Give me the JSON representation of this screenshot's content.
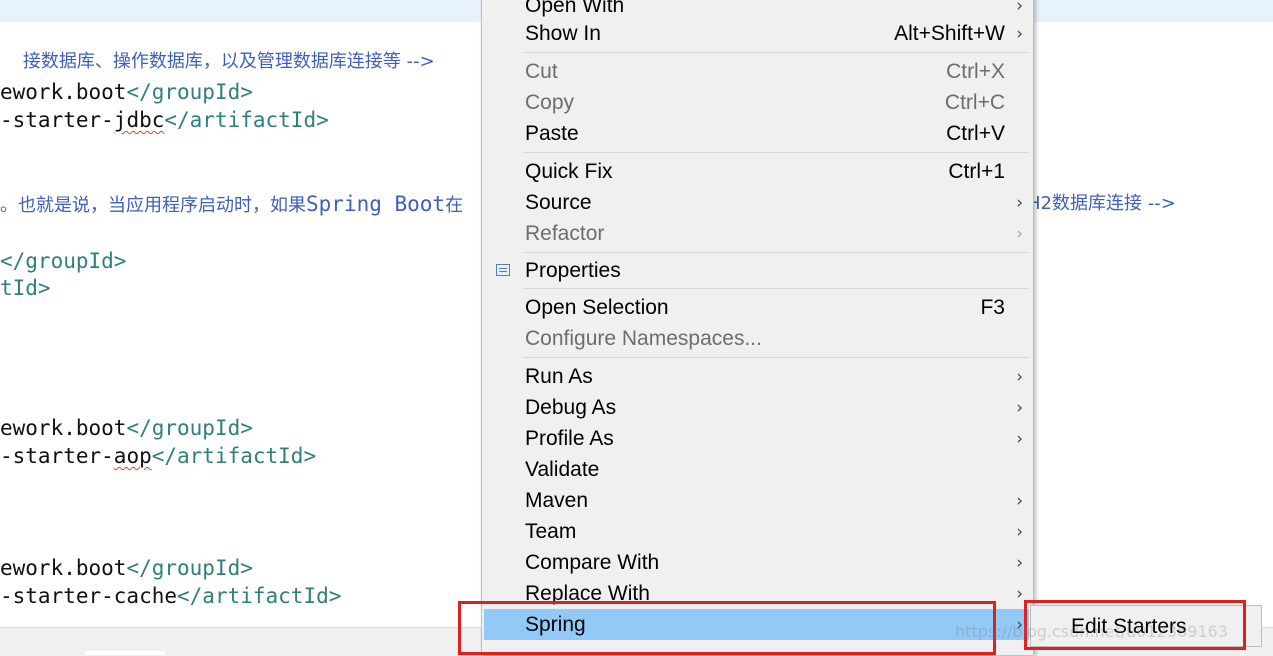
{
  "editor": {
    "comment_1": "接数据库、操作数据库，以及管理数据库连接等 -->",
    "block_1": {
      "group_pre": "ework.boot",
      "group_close": "</groupId>",
      "artifact_pre": "-starter-",
      "artifact_squig": "jdbc",
      "artifact_close": "</artifactId>"
    },
    "comment_2_text": "。也就是说，当应用程序启动时，如果",
    "comment_2_mono": "Spring Boot",
    "comment_2_tail": "在",
    "comment_2_right": "H2数据库连接 -->",
    "block_2": {
      "group_close": "</groupId>",
      "artifact_close": "tId>"
    },
    "block_3": {
      "group_pre": "ework.boot",
      "group_close": "</groupId>",
      "artifact_pre": "-starter-",
      "artifact_squig": "aop",
      "artifact_close": "</artifactId>"
    },
    "block_4": {
      "group_pre": "ework.boot",
      "group_close": "</groupId>",
      "artifact_pre": "-starter-cache",
      "artifact_close": "</artifactId>"
    }
  },
  "context_menu": {
    "items": [
      {
        "label": "Open With",
        "shortcut": "",
        "submenu": true,
        "disabled": false
      },
      {
        "label": "Show In",
        "shortcut": "Alt+Shift+W",
        "submenu": true,
        "disabled": false
      },
      {
        "label": "Cut",
        "shortcut": "Ctrl+X",
        "submenu": false,
        "disabled": true
      },
      {
        "label": "Copy",
        "shortcut": "Ctrl+C",
        "submenu": false,
        "disabled": true
      },
      {
        "label": "Paste",
        "shortcut": "Ctrl+V",
        "submenu": false,
        "disabled": false
      },
      {
        "label": "Quick Fix",
        "shortcut": "Ctrl+1",
        "submenu": false,
        "disabled": false
      },
      {
        "label": "Source",
        "shortcut": "",
        "submenu": true,
        "disabled": false
      },
      {
        "label": "Refactor",
        "shortcut": "",
        "submenu": true,
        "disabled": true
      },
      {
        "label": "Properties",
        "shortcut": "",
        "submenu": false,
        "disabled": false,
        "icon": "properties-icon"
      },
      {
        "label": "Open Selection",
        "shortcut": "F3",
        "submenu": false,
        "disabled": false
      },
      {
        "label": "Configure Namespaces...",
        "shortcut": "",
        "submenu": false,
        "disabled": true
      },
      {
        "label": "Run As",
        "shortcut": "",
        "submenu": true,
        "disabled": false
      },
      {
        "label": "Debug As",
        "shortcut": "",
        "submenu": true,
        "disabled": false
      },
      {
        "label": "Profile As",
        "shortcut": "",
        "submenu": true,
        "disabled": false
      },
      {
        "label": "Validate",
        "shortcut": "",
        "submenu": false,
        "disabled": false
      },
      {
        "label": "Maven",
        "shortcut": "",
        "submenu": true,
        "disabled": false
      },
      {
        "label": "Team",
        "shortcut": "",
        "submenu": true,
        "disabled": false
      },
      {
        "label": "Compare With",
        "shortcut": "",
        "submenu": true,
        "disabled": false
      },
      {
        "label": "Replace With",
        "shortcut": "",
        "submenu": true,
        "disabled": false
      },
      {
        "label": "Spring",
        "shortcut": "",
        "submenu": true,
        "disabled": false,
        "highlighted": true
      }
    ],
    "arrow_glyph": "›"
  },
  "spring_submenu": {
    "items": [
      {
        "label": "Edit Starters"
      }
    ]
  },
  "colors": {
    "highlight": "#91c9f7",
    "annotation_red": "#e02020",
    "xml_tag": "#2f7f7f",
    "comment": "#3f5fbf"
  }
}
